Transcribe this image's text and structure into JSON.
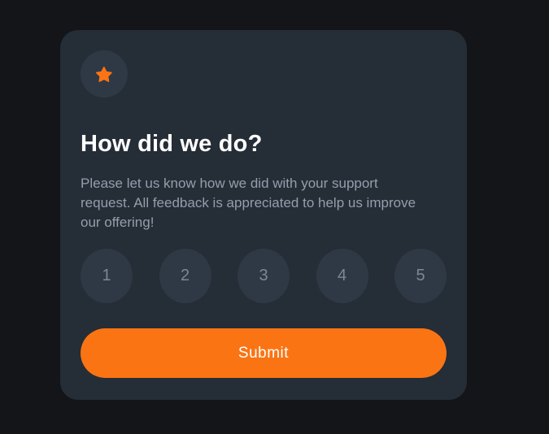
{
  "card": {
    "icon": "star-icon",
    "title": "How did we do?",
    "description": "Please let us know how we did with your support request. All feedback is appreciated to help us improve our offering!",
    "ratings": [
      "1",
      "2",
      "3",
      "4",
      "5"
    ],
    "submit_label": "Submit"
  },
  "colors": {
    "page_background": "#131518",
    "card_background": "#252d37",
    "circle_background": "#2f3946",
    "accent": "#fb7413",
    "title_text": "#ffffff",
    "body_text": "#959eac",
    "rating_text": "#7c8798"
  }
}
